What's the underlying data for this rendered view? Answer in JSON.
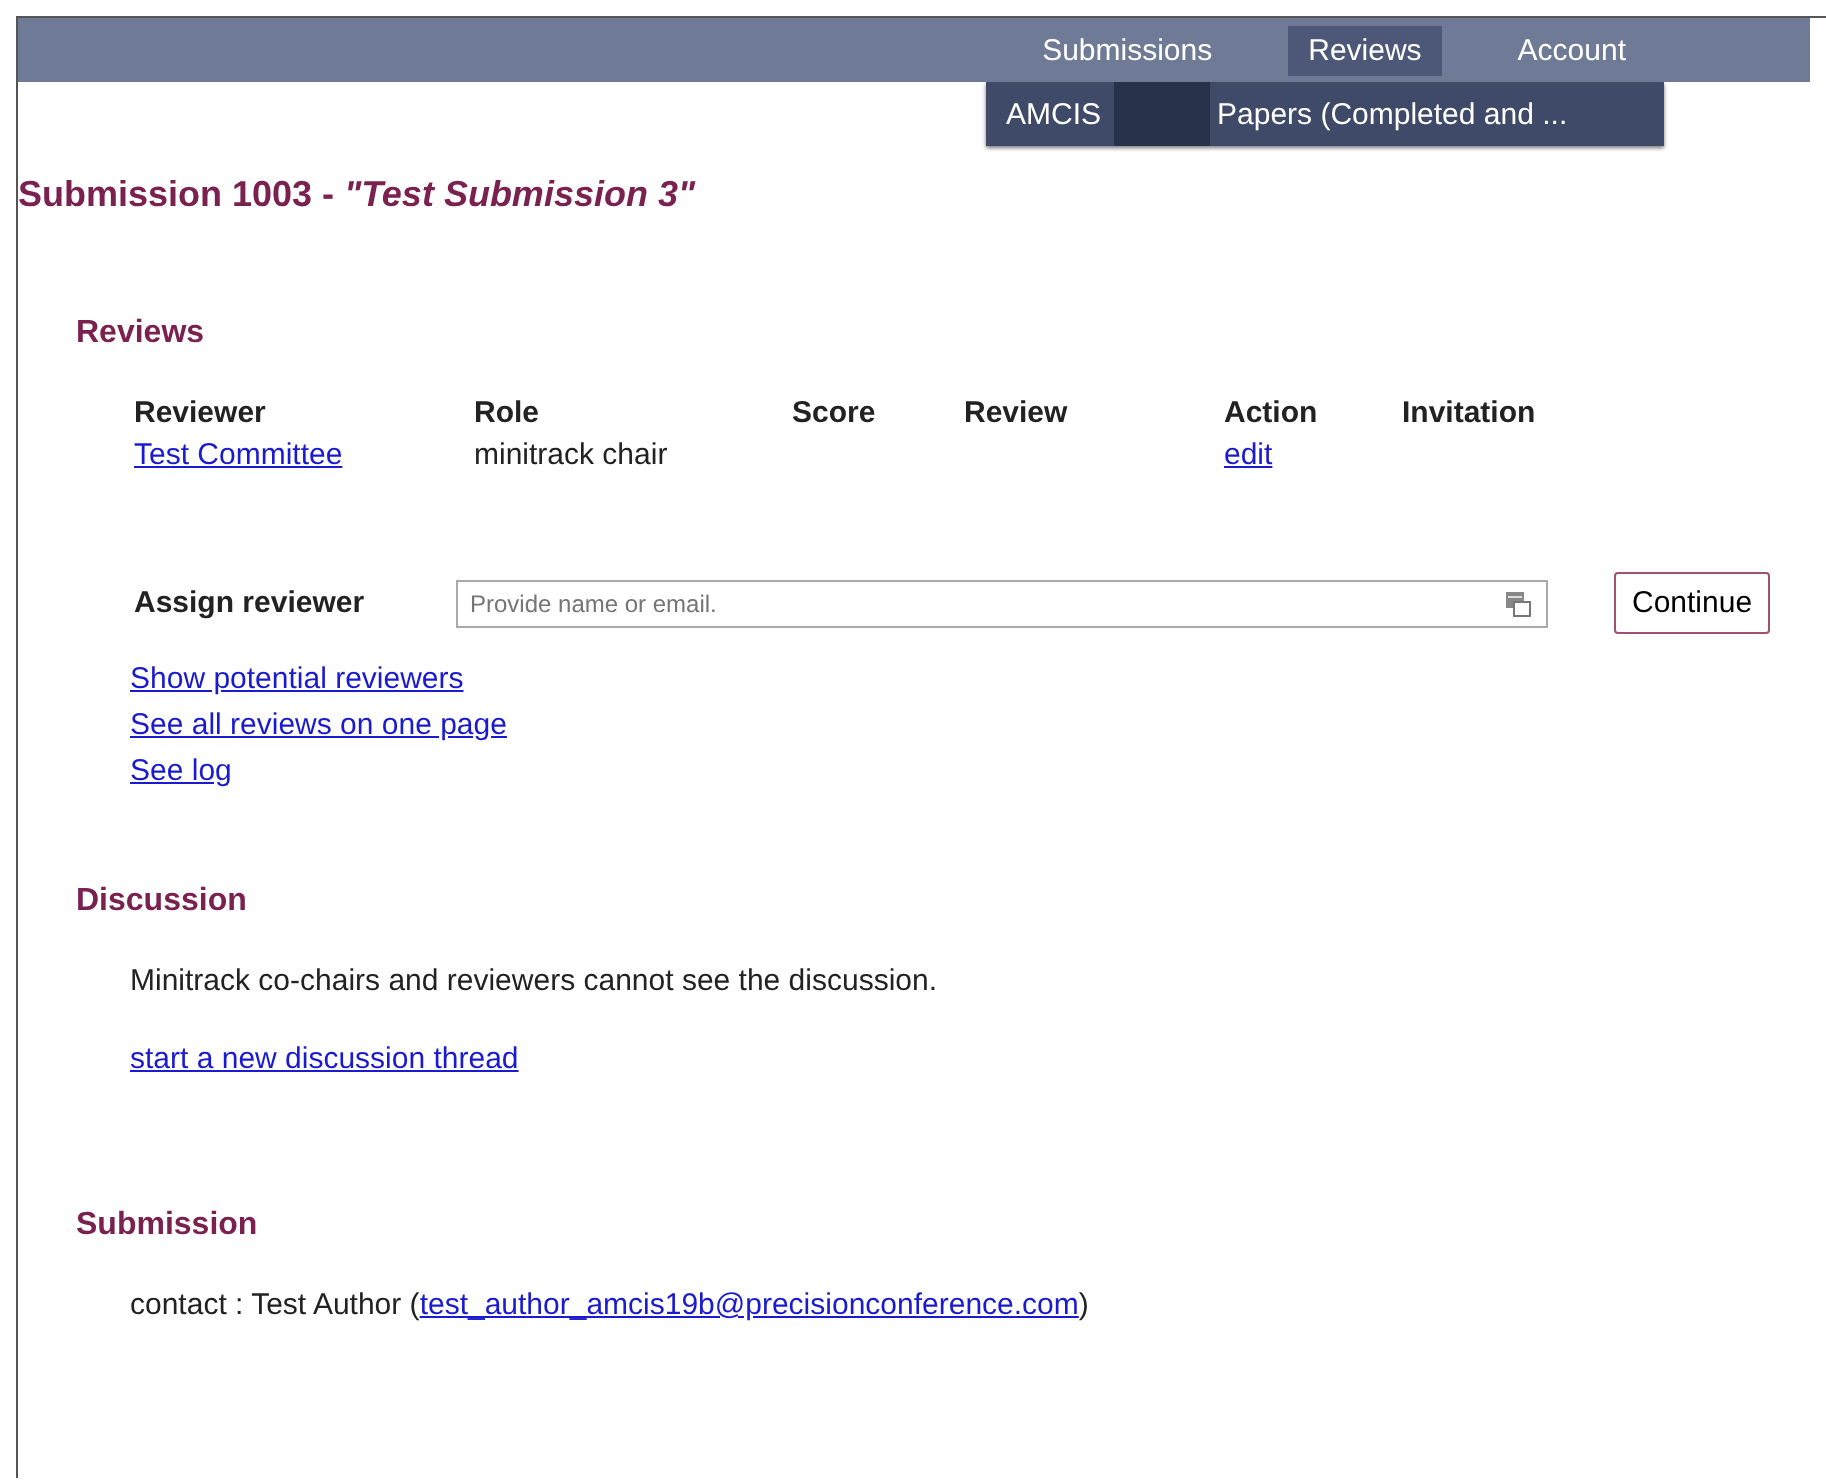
{
  "nav": {
    "items": [
      {
        "label": "Submissions",
        "selected": false
      },
      {
        "label": "Reviews",
        "selected": true
      },
      {
        "label": "Account",
        "selected": false
      }
    ],
    "submenu": {
      "prefix": "AMCIS",
      "redacted": true,
      "suffix": "Papers (Completed and ..."
    }
  },
  "title": {
    "text": "Submission 1003 - ",
    "name": "\"Test Submission 3\""
  },
  "reviews": {
    "heading": "Reviews",
    "table": {
      "columns": [
        "Reviewer",
        "Role",
        "Score",
        "Review",
        "Action",
        "Invitation"
      ],
      "rows": [
        {
          "reviewer": "Test Committee",
          "role": "minitrack chair",
          "action": "edit"
        }
      ]
    },
    "assign": {
      "label": "Assign reviewer",
      "placeholder": "Provide name or email.",
      "button": "Continue"
    },
    "links": [
      "Show potential reviewers",
      "See all reviews on one page",
      "See log"
    ]
  },
  "discussion": {
    "heading": "Discussion",
    "note": "Minitrack co-chairs and reviewers cannot see the discussion.",
    "link": "start a new discussion thread"
  },
  "submission": {
    "heading": "Submission",
    "contact_prefix": "contact : Test Author (",
    "contact_email": "test_author_amcis19b@precisionconference.com",
    "contact_suffix": ")"
  }
}
